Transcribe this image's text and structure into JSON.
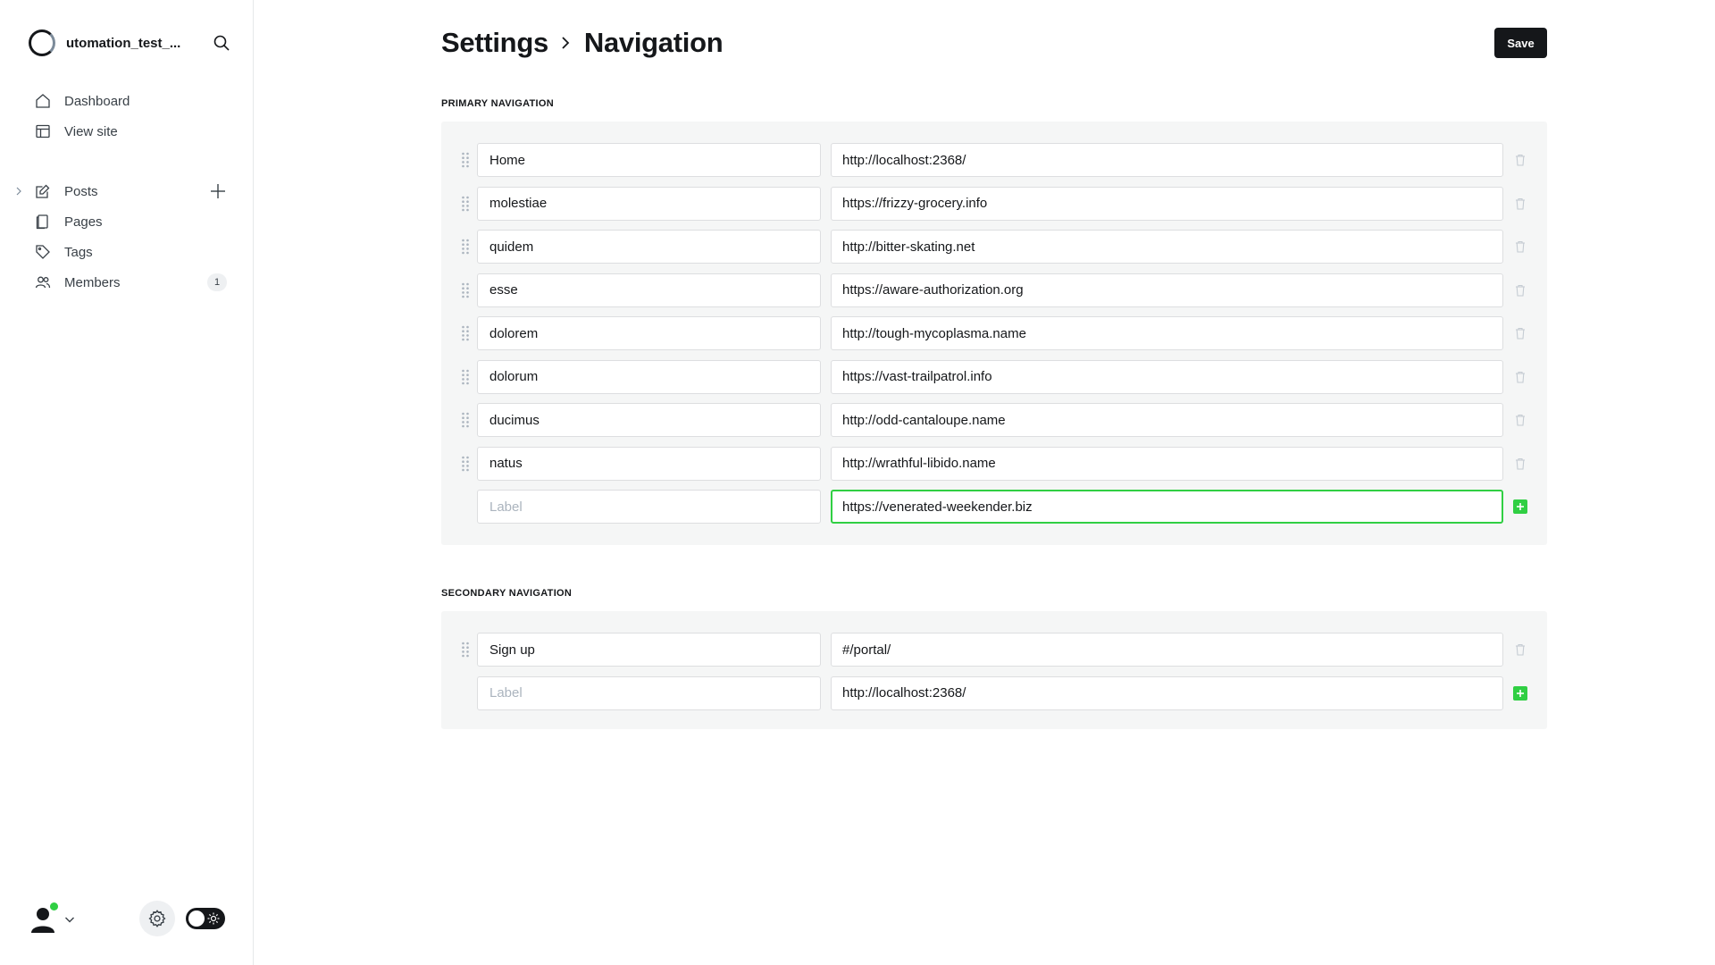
{
  "sidebar": {
    "site_name": "utomation_test_...",
    "items": [
      {
        "label": "Dashboard",
        "icon": "home-icon"
      },
      {
        "label": "View site",
        "icon": "layout-icon"
      },
      {
        "label": "Posts",
        "icon": "edit-icon"
      },
      {
        "label": "Pages",
        "icon": "pages-icon"
      },
      {
        "label": "Tags",
        "icon": "tag-icon"
      },
      {
        "label": "Members",
        "icon": "members-icon",
        "badge": "1"
      }
    ]
  },
  "header": {
    "crumb_parent": "Settings",
    "crumb_current": "Navigation",
    "save_label": "Save"
  },
  "primary": {
    "title": "PRIMARY NAVIGATION",
    "items": [
      {
        "label": "Home",
        "url": "http://localhost:2368/"
      },
      {
        "label": "molestiae",
        "url": "https://frizzy-grocery.info"
      },
      {
        "label": "quidem",
        "url": "http://bitter-skating.net"
      },
      {
        "label": "esse",
        "url": "https://aware-authorization.org"
      },
      {
        "label": "dolorem",
        "url": "http://tough-mycoplasma.name"
      },
      {
        "label": "dolorum",
        "url": "https://vast-trailpatrol.info"
      },
      {
        "label": "ducimus",
        "url": "http://odd-cantaloupe.name"
      },
      {
        "label": "natus",
        "url": "http://wrathful-libido.name"
      }
    ],
    "new_item": {
      "label_placeholder": "Label",
      "url": "https://venerated-weekender.biz"
    }
  },
  "secondary": {
    "title": "SECONDARY NAVIGATION",
    "items": [
      {
        "label": "Sign up",
        "url": "#/portal/"
      }
    ],
    "new_item": {
      "label_placeholder": "Label",
      "url": "http://localhost:2368/"
    }
  },
  "colors": {
    "accent": "#30cf43",
    "primary_button": "#15171a",
    "panel_background": "#f5f6f6"
  }
}
